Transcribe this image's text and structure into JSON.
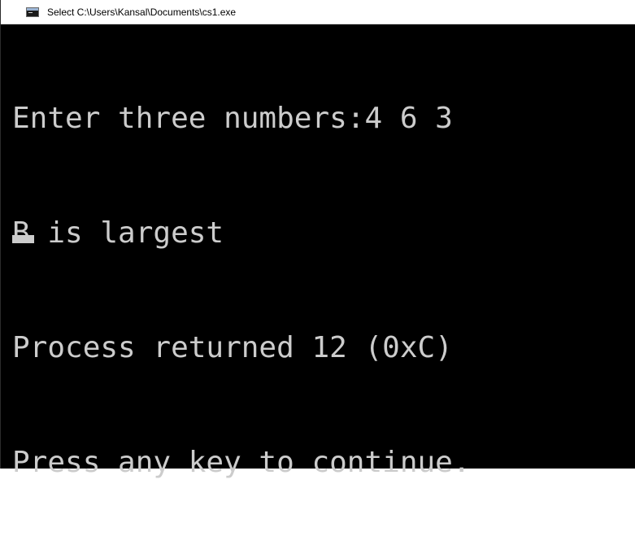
{
  "window": {
    "title": "Select C:\\Users\\Kansal\\Documents\\cs1.exe",
    "icon": "console-app-icon"
  },
  "console": {
    "lines": [
      "Enter three numbers:4 6 3",
      "B is largest",
      "Process returned 12 (0xC)",
      "Press any key to continue."
    ]
  },
  "colors": {
    "background": "#000000",
    "text": "#cccccc",
    "titlebar": "#ffffff"
  }
}
